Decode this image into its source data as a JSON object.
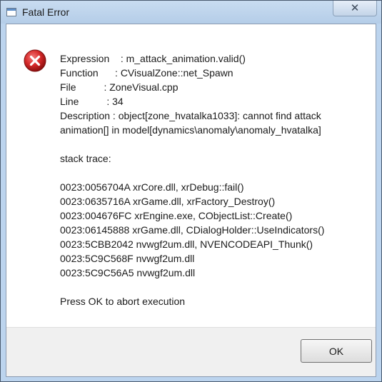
{
  "window": {
    "title": "Fatal Error"
  },
  "icons": {
    "app": "window-icon",
    "close": "close-icon",
    "error": "error-icon"
  },
  "colors": {
    "error_red": "#d62a2a",
    "footer_bg": "#f0f0f0",
    "title_bar": "#bcd4ee"
  },
  "message": {
    "expression": "Expression    : m_attack_animation.valid()",
    "function": "Function      : CVisualZone::net_Spawn",
    "file": "File          : ZoneVisual.cpp",
    "line": "Line          : 34",
    "description": "Description   : object[zone_hvatalka1033]: cannot find attack animation[] in model[dynamics\\anomaly\\anomaly_hvatalka]",
    "stack_header": "stack trace:",
    "stack": [
      "0023:0056704A xrCore.dll, xrDebug::fail()",
      "0023:0635716A xrGame.dll, xrFactory_Destroy()",
      "0023:004676FC xrEngine.exe, CObjectList::Create()",
      "0023:06145888 xrGame.dll, CDialogHolder::UseIndicators()",
      "0023:5CBB2042 nvwgf2um.dll, NVENCODEAPI_Thunk()",
      "0023:5C9C568F nvwgf2um.dll",
      "0023:5C9C56A5 nvwgf2um.dll"
    ],
    "footer_text": "Press OK to abort execution"
  },
  "buttons": {
    "ok_label": "OK",
    "close_glyph": "✕"
  }
}
